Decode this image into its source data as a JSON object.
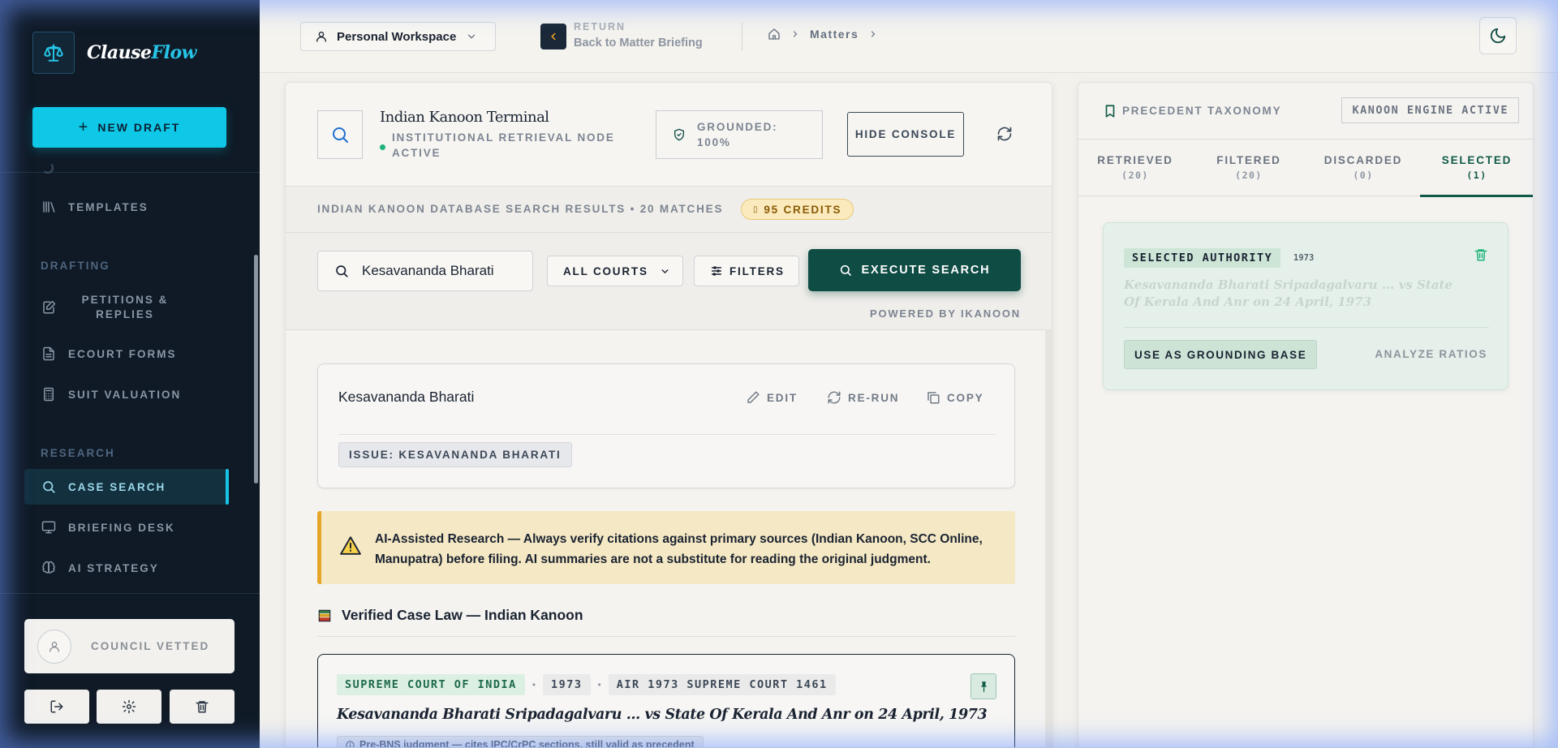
{
  "brand": {
    "name_part1": "Clause",
    "name_part2": "Flow",
    "logo_icon": "scales-icon"
  },
  "sidebar": {
    "new_draft": "NEW DRAFT",
    "templates": "TEMPLATES",
    "sections": {
      "drafting": "DRAFTING",
      "research": "RESEARCH"
    },
    "items": {
      "petitions": "PETITIONS & REPLIES",
      "ecourt_forms": "ECOURT FORMS",
      "suit_valuation": "SUIT VALUATION",
      "case_search": "CASE SEARCH",
      "briefing_desk": "BRIEFING DESK",
      "ai_strategy": "AI STRATEGY"
    },
    "council_vetted": "COUNCIL VETTED"
  },
  "topbar": {
    "workspace": "Personal Workspace",
    "return_label": "RETURN",
    "return_sub": "Back to Matter Briefing",
    "breadcrumb": "Matters"
  },
  "terminal": {
    "title": "Indian Kanoon Terminal",
    "status": "INSTITUTIONAL RETRIEVAL NODE ACTIVE",
    "grounded": "GROUNDED: 100%",
    "hide_console": "HIDE CONSOLE"
  },
  "results": {
    "summary": "INDIAN KANOON DATABASE SEARCH RESULTS • 20 MATCHES",
    "credits": "95 CREDITS"
  },
  "search": {
    "query": "Kesavananda Bharati",
    "courts": "ALL COURTS",
    "filters": "FILTERS",
    "execute": "EXECUTE SEARCH",
    "powered_by": "POWERED BY IKANOON"
  },
  "query_card": {
    "query": "Kesavananda Bharati",
    "edit": "EDIT",
    "rerun": "RE-RUN",
    "copy": "COPY",
    "issue": "ISSUE: KESAVANANDA BHARATI"
  },
  "warning": "AI-Assisted Research — Always verify citations against primary sources (Indian Kanoon, SCC Online, Manupatra) before filing. AI summaries are not a substitute for reading the original judgment.",
  "verified_heading": "Verified Case Law — Indian Kanoon",
  "case": {
    "court": "SUPREME COURT OF INDIA",
    "year": "1973",
    "citation": "AIR 1973 SUPREME COURT 1461",
    "title": "Kesavananda Bharati Sripadagalvaru ... vs State Of Kerala And Anr on 24 April, 1973",
    "note": "Pre-BNS judgment — cites IPC/CrPC sections, still valid as precedent"
  },
  "taxonomy": {
    "title": "PRECEDENT TAXONOMY",
    "engine": "KANOON ENGINE ACTIVE",
    "tabs": [
      {
        "label": "RETRIEVED",
        "count": "(20)"
      },
      {
        "label": "FILTERED",
        "count": "(20)"
      },
      {
        "label": "DISCARDED",
        "count": "(0)"
      },
      {
        "label": "SELECTED",
        "count": "(1)"
      }
    ],
    "active_tab": "SELECTED",
    "selected": {
      "tag": "SELECTED AUTHORITY",
      "year": "1973",
      "title": "Kesavananda Bharati Sripadagalvaru ... vs State Of Kerala And Anr on 24 April, 1973",
      "use_as_base": "USE AS GROUNDING BASE",
      "analyze": "ANALYZE RATIOS"
    }
  },
  "colors": {
    "sidebar_bg": "#0f1a26",
    "accent_cyan": "#0fc8e8",
    "execute_green": "#0f4c44",
    "active_tab_green": "#0f5a46",
    "warning_bg": "#f5e8c4",
    "credits_bg": "#fbeabd"
  }
}
